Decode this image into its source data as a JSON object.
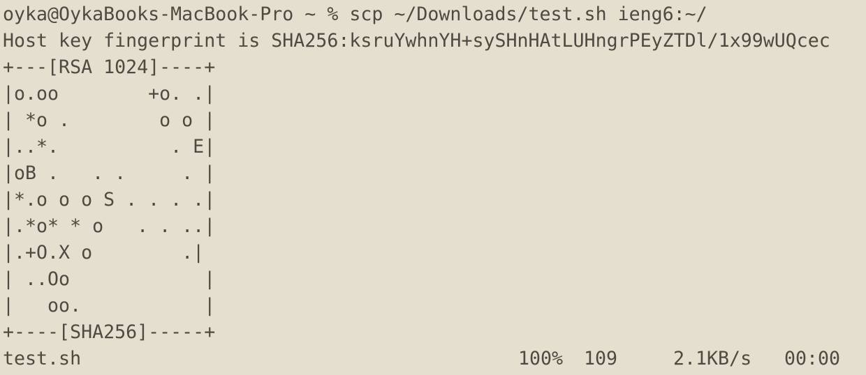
{
  "terminal": {
    "prompt_command": "oyka@OykaBooks-MacBook-Pro ~ % scp ~/Downloads/test.sh ieng6:~/",
    "fingerprint_line": "Host key fingerprint is SHA256:ksruYwhnYH+sySHnHAtLUHngrPEyZTDl/1x99wUQcec",
    "randomart": [
      "+---[RSA 1024]----+",
      "|o.oo        +o. .|",
      "| *o .        o o |",
      "|..*.          . E|",
      "|oB .   . .     . |",
      "|*.o o o S . . . .|",
      "|.*o* * o   . . ..|",
      "|.+O.X o        .|",
      "| ..Oo            |",
      "|   oo.           |",
      "+----[SHA256]-----+"
    ],
    "progress": {
      "file": "test.sh",
      "percent": "100%",
      "size": "109",
      "rate": "2.1KB/s",
      "eta": "00:00"
    }
  }
}
